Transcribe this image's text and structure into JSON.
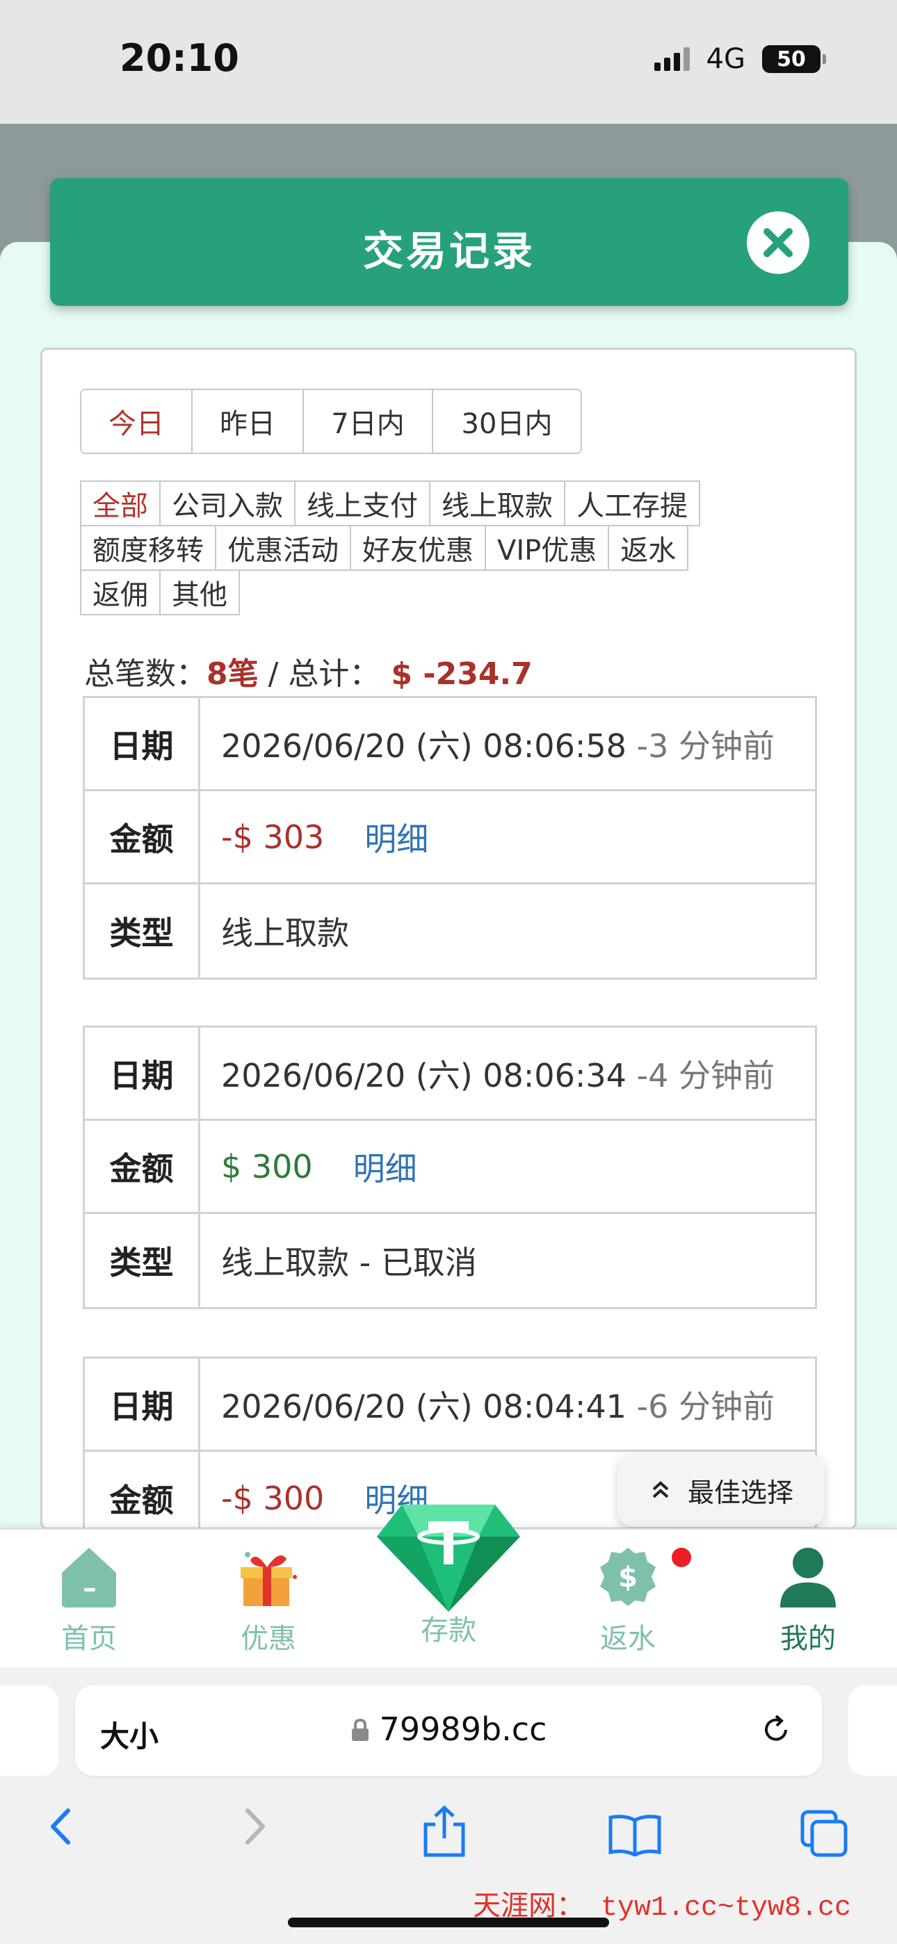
{
  "status": {
    "time": "20:10",
    "network": "4G",
    "battery": "50"
  },
  "modal": {
    "title": "交易记录"
  },
  "date_tabs": [
    "今日",
    "昨日",
    "7日内",
    "30日内"
  ],
  "date_active": "今日",
  "type_tabs": [
    [
      "全部",
      "公司入款",
      "线上支付",
      "线上取款",
      "人工存提"
    ],
    [
      "额度移转",
      "优惠活动",
      "好友优惠",
      "VIP优惠",
      "返水"
    ],
    [
      "返佣",
      "其他"
    ]
  ],
  "type_active": "全部",
  "summary": {
    "count_label": "总笔数：",
    "count": "8笔",
    "sep": " / ",
    "total_label": "总计：",
    "total": "$ -234.7"
  },
  "labels": {
    "date": "日期",
    "amount": "金额",
    "type": "类型",
    "detail": "明细"
  },
  "records": [
    {
      "date": "2026/06/20 (六) 08:06:58",
      "ago": "-3 分钟前",
      "amount": "-$ 303",
      "sign": "neg",
      "type": "线上取款"
    },
    {
      "date": "2026/06/20 (六) 08:06:34",
      "ago": "-4 分钟前",
      "amount": "$ 300",
      "sign": "pos",
      "type": "线上取款 - 已取消"
    },
    {
      "date": "2026/06/20 (六) 08:04:41",
      "ago": "-6 分钟前",
      "amount": "-$ 300",
      "sign": "neg",
      "type": ""
    }
  ],
  "best_choice": "最佳选择",
  "nav": {
    "home": "首页",
    "promo": "优惠",
    "deposit": "存款",
    "rebate": "返水",
    "mine": "我的"
  },
  "browser": {
    "text_size": "大小",
    "url": "79989b.cc"
  },
  "watermark": "天涯网： tyw1.cc~tyw8.cc",
  "colors": {
    "brand": "#26a17b",
    "negative": "#a8322a",
    "positive": "#2f7a3a",
    "link": "#2f73b5"
  }
}
